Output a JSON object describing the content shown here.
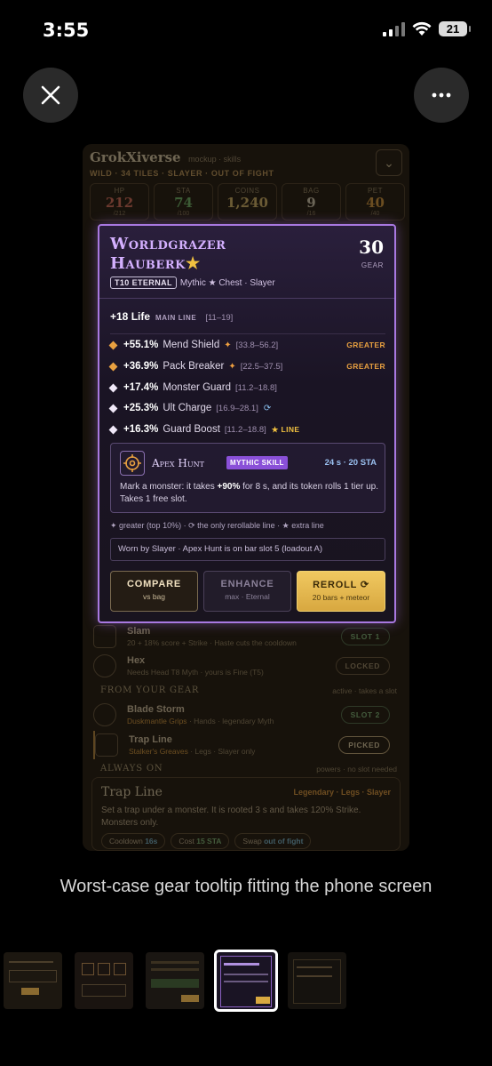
{
  "status_bar": {
    "time": "3:55",
    "battery": "21"
  },
  "viewer": {
    "close_icon": "close-icon",
    "more_icon": "more-horizontal-icon",
    "caption": "Worst-case gear tooltip fitting the phone screen"
  },
  "app": {
    "title": "GrokXiverse",
    "subtitle": "mockup · skills",
    "tags": "WILD · 34 TILES · SLAYER · OUT OF FIGHT",
    "stats": [
      {
        "label": "HP",
        "value": "212",
        "max": "/212",
        "color": "#e07060"
      },
      {
        "label": "STA",
        "value": "74",
        "max": "/100",
        "color": "#70c070"
      },
      {
        "label": "COINS",
        "value": "1,240",
        "max": "",
        "color": "#e0c070"
      },
      {
        "label": "BAG",
        "value": "9",
        "max": "/16",
        "color": "#e0d8c0"
      },
      {
        "label": "PET",
        "value": "40",
        "max": "/40",
        "color": "#e0a040"
      }
    ],
    "skills": [
      {
        "name": "Slam",
        "desc": "20 + 18% score + Strike · Haste cuts the cooldown",
        "pill": "SLOT 1"
      },
      {
        "name": "Hex",
        "desc": "Needs Head T8 Myth · yours is Fine (T5)",
        "pill": "LOCKED"
      },
      {
        "name": "Blade Storm",
        "source": "Duskmantle Grips",
        "desc": "· Hands · legendary Myth",
        "pill": "SLOT 2"
      },
      {
        "name": "Trap Line",
        "source": "Stalker's Greaves",
        "desc": "· Legs · Slayer only",
        "pill": "PICKED"
      }
    ],
    "section_gear": {
      "title": "FROM YOUR GEAR",
      "note": "active · takes a slot"
    },
    "section_always": {
      "title": "ALWAYS ON",
      "note": "powers · no slot needed"
    },
    "trap_card": {
      "title": "Trap Line",
      "tags": "Legendary · Legs · Slayer",
      "desc": "Set a trap under a monster. It is rooted 3 s and takes 120% Strike. Monsters only.",
      "chips": [
        {
          "label": "Cooldown",
          "value": "16s"
        },
        {
          "label": "Cost",
          "value": "15 STA"
        },
        {
          "label": "Swap",
          "value": "out of fight"
        }
      ]
    }
  },
  "tooltip": {
    "name_line1": "Worldgrazer",
    "name_line2": "Hauberk",
    "star": "★",
    "level": "30",
    "level_label": "GEAR",
    "tier": "T10 ETERNAL",
    "meta": "Mythic ★ Chest · Slayer",
    "main_line": {
      "value": "+18 Life",
      "label": "MAIN LINE",
      "range": "[11–19]"
    },
    "affixes": [
      {
        "value": "+55.1%",
        "name": "Mend Shield",
        "mark": "✦",
        "range": "[33.8–56.2]",
        "tag": "GREATER",
        "color": "#e8a040"
      },
      {
        "value": "+36.9%",
        "name": "Pack Breaker",
        "mark": "✦",
        "range": "[22.5–37.5]",
        "tag": "GREATER",
        "color": "#e8a040"
      },
      {
        "value": "+17.4%",
        "name": "Monster Guard",
        "mark": "",
        "range": "[11.2–18.8]",
        "tag": "",
        "color": "#f0e8f8"
      },
      {
        "value": "+25.3%",
        "name": "Ult Charge",
        "mark": "",
        "range": "[16.9–28.1]",
        "tag": "⟳",
        "color": "#f0e8f8"
      },
      {
        "value": "+16.3%",
        "name": "Guard Boost",
        "mark": "",
        "range": "[11.2–18.8]",
        "tag": "★ LINE",
        "color": "#f0e8f8"
      }
    ],
    "skill": {
      "icon": "crosshair-icon",
      "name": "Apex Hunt",
      "badge": "MYTHIC SKILL",
      "cost": "24 s · 20 STA",
      "desc_pre": "Mark a monster: it takes ",
      "desc_bold": "+90%",
      "desc_post": " for 8 s, and its token rolls 1 tier up. Takes 1 free slot."
    },
    "legend": "✦ greater (top 10%) · ⟳ the only rerollable line · ★ extra line",
    "worn": "Worn by Slayer · Apex Hunt is on bar slot 5 (loadout A)",
    "buttons": {
      "compare": {
        "label": "COMPARE",
        "sub": "vs bag"
      },
      "enhance": {
        "label": "ENHANCE",
        "sub": "max · Eternal"
      },
      "reroll": {
        "label": "REROLL ⟳",
        "sub": "20 bars + meteor"
      }
    }
  }
}
